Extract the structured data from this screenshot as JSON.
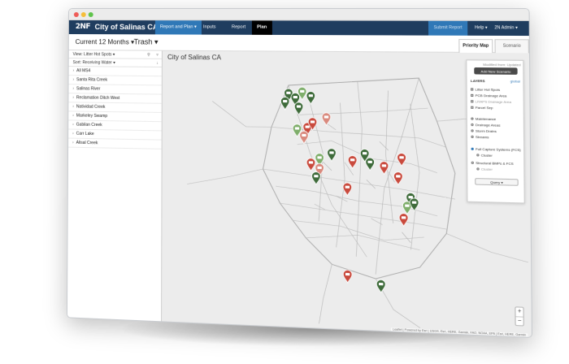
{
  "window_title": "City of Salinas CA",
  "logo": "2NF",
  "nav": {
    "tabs": [
      "Report and Plan ▾",
      "Inputs",
      "Report",
      "Plan"
    ],
    "submit": "Submit Report",
    "help": "Help ▾",
    "user": "2N Admin ▾"
  },
  "subbar": {
    "period": "Current 12 Months ▾",
    "metric": "Trash ▾",
    "tab_priority": "Priority Map",
    "tab_scenario": "Scenario"
  },
  "sidebar": {
    "view_label": "View: Litter Hot Spots ▾",
    "sort_label": "Sort: Receiving Water ▾",
    "items": [
      "All MS4",
      "Santa Rita Creek",
      "Salinas River",
      "Reclamation Ditch West",
      "Natividad Creek",
      "Markeley Swamp",
      "Gabilan Creek",
      "Carr Lake",
      "Alisal Creek"
    ]
  },
  "map": {
    "title": "City of Salinas CA",
    "panel": {
      "note": "Modified from: Updated",
      "top_button": "Add New Scenario",
      "layers_label": "LAYERS",
      "layers_link": "global",
      "layers": [
        "Litter Hot Spots",
        "PCB Drainage Area",
        "LRAPS Drainage Area",
        "Parcel Sep"
      ],
      "groups": [
        "Maintenance",
        "Drainage Areas",
        "Storm Drains",
        "Streams"
      ],
      "option1": "Full Capture Systems (FCS)",
      "option1_sub": "Cluster",
      "option2": "Structural BMPs & FCS",
      "option2_sub": "Cluster",
      "button": "Query ▾"
    },
    "zoom_in": "+",
    "zoom_out": "−",
    "attribution": "Leaflet | Powered by Esri | USGS, Esri, HERE, Garmin, FAO, NOAA, EPA | Esri, HERE, Garmin"
  },
  "pin_colors": {
    "green": "#3e6b3a",
    "red": "#c94a3d",
    "pale_green": "#7fae6b",
    "pale_red": "#d98a7e"
  }
}
